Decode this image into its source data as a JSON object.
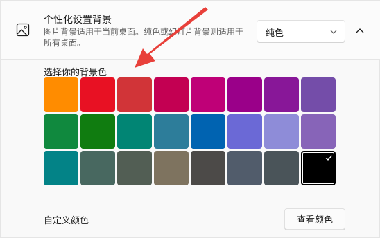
{
  "header": {
    "title": "个性化设置背景",
    "description": "图片背景适用于当前桌面。纯色或幻灯片背景则适用于所有桌面。",
    "select_value": "纯色",
    "icons": {
      "picture": "picture-icon",
      "dropdown": "chevron-down-icon",
      "collapse": "chevron-up-icon"
    }
  },
  "colors_section": {
    "label": "选择你的背景色",
    "selected_index": 23,
    "swatches": [
      "#ff8c00",
      "#e81123",
      "#d13438",
      "#c30052",
      "#bf0077",
      "#9a0089",
      "#881798",
      "#744da9",
      "#10893e",
      "#107c10",
      "#018574",
      "#2d7d9a",
      "#0063b1",
      "#6b69d6",
      "#8e8cd8",
      "#8764b8",
      "#038387",
      "#486860",
      "#525e54",
      "#7e735f",
      "#4c4a48",
      "#515c6b",
      "#4a5459",
      "#000000"
    ]
  },
  "custom": {
    "label": "自定义颜色",
    "button_label": "查看颜色"
  },
  "annotation": {
    "arrow_color": "#e8403a"
  }
}
